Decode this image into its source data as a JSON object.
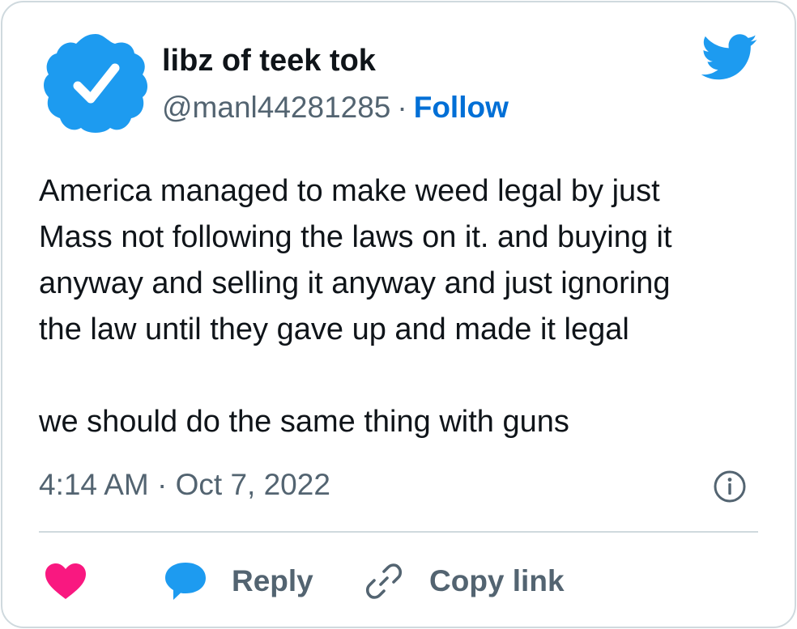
{
  "author": {
    "display_name": "libz of teek tok",
    "handle": "@manl44281285",
    "separator": "·",
    "follow_label": "Follow",
    "avatar_icon": "verified-badge-icon"
  },
  "brand": {
    "icon": "twitter-bird-icon",
    "color": "#1d9bf0"
  },
  "tweet": {
    "text": "America managed to make weed legal by just\nMass not following the laws on it. and buying it\nanyway and selling it anyway and just ignoring\nthe law until they gave up and made it legal\n\nwe should do the same thing with guns",
    "timestamp": "4:14 AM · Oct 7, 2022"
  },
  "actions": {
    "like_icon": "heart-icon",
    "reply_label": "Reply",
    "reply_icon": "speech-bubble-icon",
    "copy_label": "Copy link",
    "copy_icon": "link-icon",
    "info_icon": "info-icon"
  },
  "colors": {
    "text": "#0f1419",
    "secondary": "#536471",
    "link": "#006fd6",
    "heart": "#f91880",
    "accent": "#1d9bf0",
    "border": "#cfd9de"
  }
}
